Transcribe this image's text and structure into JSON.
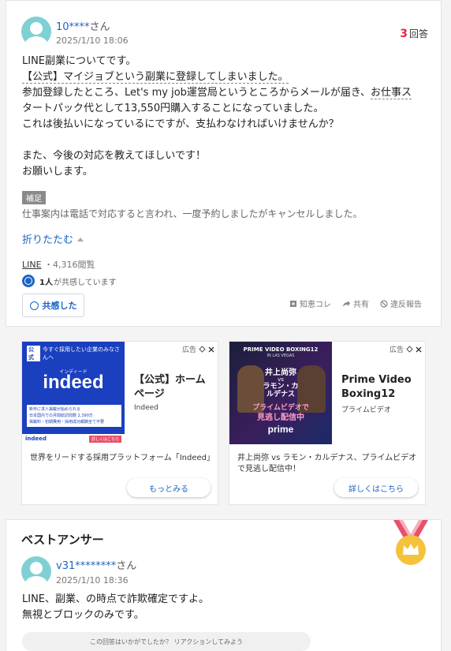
{
  "question": {
    "user": "10****",
    "user_suffix": "さん",
    "date": "2025/1/10 18:06",
    "answer_count": "3",
    "answer_label": "回答",
    "body": {
      "l1": "LINE副業についてです。",
      "l2": "【公式】マイジョブという副業に登録してしまいました。",
      "l3a": "参加登録したところ、Let's my job運営局というところからメールが届き、",
      "l3b": "お仕事ス",
      "l4": "タートパック代として13,550円購入することになっていました。",
      "l5a": "これは後払いになっているにですが、支払わなければいけませんか？",
      "l6": "また、今後の対応を教えてほしいです！",
      "l7": "お願いします。"
    },
    "supplement_label": "補足",
    "supplement_text": "仕事案内は電話で対応すると言われ、一度予約しましたがキャンセルしました。",
    "fold_label": "折りたたむ",
    "category": "LINE",
    "views": "・4,316閲覧",
    "empathy_count": "1人",
    "empathy_text": "が共感しています",
    "empathy_button": "共感した",
    "actions": {
      "knowledge": "知恵コレ",
      "share": "共有",
      "report": "違反報告"
    }
  },
  "ads": [
    {
      "label": "広告",
      "banner_tag": "公式",
      "banner_head": "今すぐ採用したい企業のみなさんへ",
      "banner_kana": "インディード",
      "banner_logo": "indeed",
      "banner_points": [
        "新卒に求人掲載が始められる",
        "日本国内での月間総訪問数 2,390万",
        "掲載料・初期費用・採用成功報酬全て不要"
      ],
      "banner_footer_logo": "indeed",
      "banner_footer_btn": "詳しくはこちら",
      "title": "【公式】ホームページ",
      "sponsor": "Indeed",
      "desc": "世界をリードする採用プラットフォーム「Indeed」",
      "button": "もっとみる"
    },
    {
      "label": "広告",
      "banner_head": "PRIME VIDEO BOXING12",
      "banner_sub": "IN LAS VEGAS",
      "banner_name1": "井上尚弥",
      "banner_vs": "vs",
      "banner_name2": "ラモン・カルデナス",
      "banner_line1": "プライムビデオで",
      "banner_line2": "見逃し配信中",
      "banner_logo": "prime",
      "title": "Prime Video Boxing12",
      "sponsor": "プライムビデオ",
      "desc": "井上尚弥 vs ラモン・カルデナス、プライムビデオで見逃し配信中！",
      "button": "詳しくはこちら"
    }
  ],
  "best_answer": {
    "heading": "ベストアンサー",
    "user": "v31********",
    "user_suffix": "さん",
    "date": "2025/1/10 18:36",
    "l1": "LINE、副業、の時点で詐欺確定ですよ。",
    "l2": "無視とブロックのみです。",
    "reaction_prompt": "この回答はいかがでしたか？ リアクションしてみよう"
  },
  "colors": {
    "link": "#1c64c4",
    "accent_count": "#e8263f",
    "medal": "#f5c23b",
    "indeed_blue": "#1a3fbf"
  }
}
